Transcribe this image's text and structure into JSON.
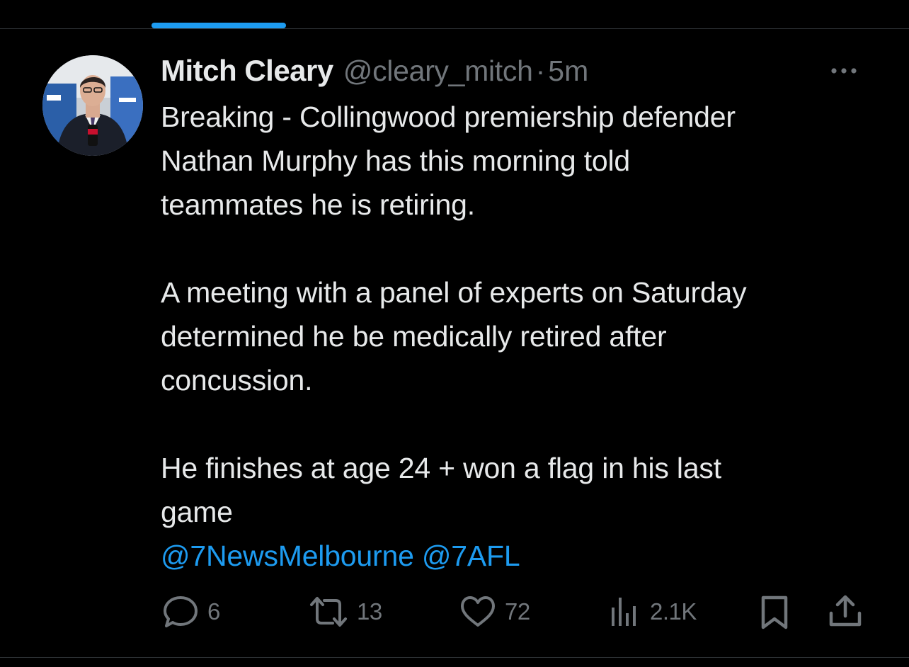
{
  "tweet": {
    "author": {
      "display_name": "Mitch Cleary",
      "handle": "@cleary_mitch",
      "separator": "·",
      "timestamp": "5m"
    },
    "body": {
      "para1_line1": "Breaking - Collingwood premiership defender",
      "para1_line2": "Nathan Murphy has this morning told",
      "para1_line3": "teammates he is retiring.",
      "para2_line1": "A meeting with a panel of experts on Saturday",
      "para2_line2": "determined he be medically retired after",
      "para2_line3": "concussion.",
      "para3_line1": "He finishes at age 24 + won a flag in his last",
      "para3_line2": "game",
      "mention1": "@7NewsMelbourne",
      "mention2": "@7AFL"
    },
    "actions": {
      "replies": "6",
      "reposts": "13",
      "likes": "72",
      "views": "2.1K"
    }
  },
  "icons": {
    "more": "more-horizontal-icon",
    "reply": "reply-icon",
    "repost": "repost-icon",
    "like": "heart-icon",
    "views": "views-chart-icon",
    "bookmark": "bookmark-icon",
    "share": "share-icon"
  },
  "colors": {
    "background": "#000000",
    "text_primary": "#e7e9ea",
    "text_secondary": "#71767b",
    "accent": "#1d9bf0",
    "divider": "#2f3336"
  }
}
